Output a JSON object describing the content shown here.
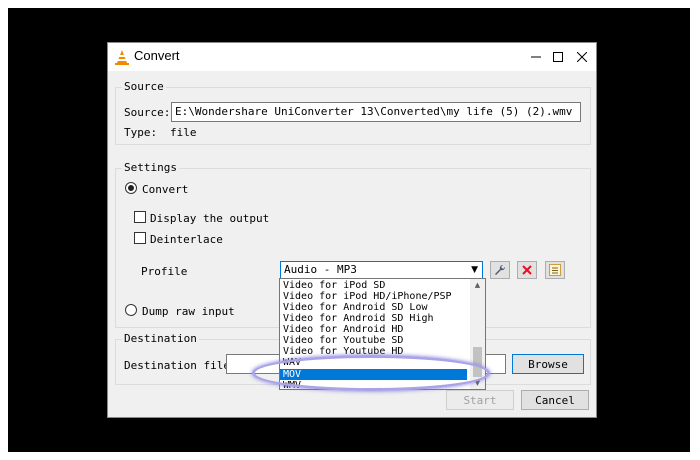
{
  "window": {
    "title": "Convert"
  },
  "source": {
    "group_label": "Source",
    "source_label": "Source:",
    "source_value": "E:\\Wondershare UniConverter 13\\Converted\\my life (5) (2).wmv",
    "type_label": "Type:",
    "type_value": "file"
  },
  "settings": {
    "group_label": "Settings",
    "convert_label": "Convert",
    "display_output_label": "Display the output",
    "deinterlace_label": "Deinterlace",
    "profile_label": "Profile",
    "profile_selected": "Audio - MP3",
    "dump_raw_label": "Dump raw input"
  },
  "profile_options": [
    "Video for iPod SD",
    "Video for iPod HD/iPhone/PSP",
    "Video for Android SD Low",
    "Video for Android SD High",
    "Video for Android HD",
    "Video for Youtube SD",
    "Video for Youtube HD",
    "WAV",
    "MOV",
    "WMV"
  ],
  "destination": {
    "group_label": "Destination",
    "file_label": "Destination file:",
    "file_value": "",
    "browse_label": "Browse"
  },
  "footer": {
    "start_label": "Start",
    "cancel_label": "Cancel"
  },
  "colors": {
    "accent": "#0078d7",
    "highlight_ring": "#a9a3e8",
    "delete_red": "#e81123"
  },
  "icons": {
    "app": "vlc-cone-icon",
    "settings": "wrench-icon",
    "delete": "red-x-icon",
    "new_profile": "list-icon"
  }
}
